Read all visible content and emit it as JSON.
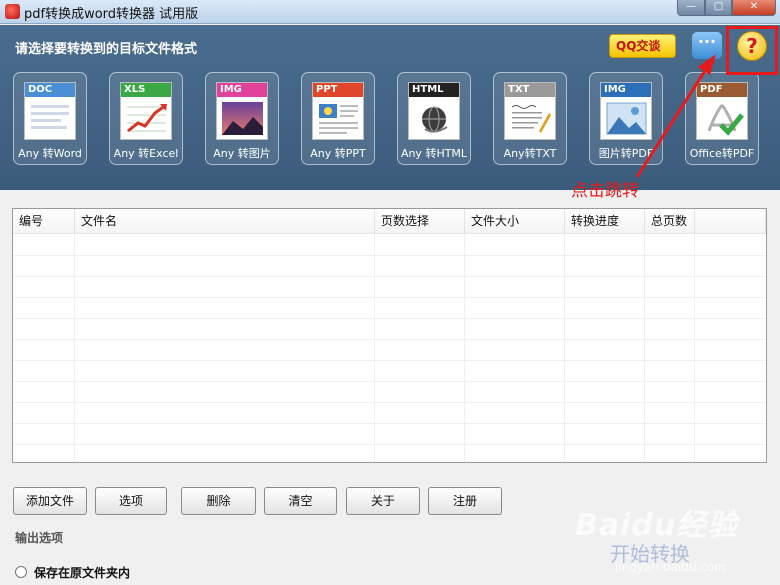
{
  "window": {
    "title": "pdf转换成word转换器 试用版",
    "min_glyph": "—",
    "max_glyph": "□",
    "close_glyph": "✕"
  },
  "toolbar": {
    "prompt": "请选择要转换到的目标文件格式",
    "qq_label": "QQ交谈",
    "chat_glyph": "···",
    "help_glyph": "?"
  },
  "formats": [
    {
      "tag": "DOC",
      "label": "Any 转Word",
      "color": "#4a8fd6",
      "icon": "word-doc-icon"
    },
    {
      "tag": "XLS",
      "label": "Any 转Excel",
      "color": "#3aa845",
      "icon": "excel-chart-icon"
    },
    {
      "tag": "IMG",
      "label": "Any 转图片",
      "color": "#e0429a",
      "icon": "image-icon"
    },
    {
      "tag": "PPT",
      "label": "Any 转PPT",
      "color": "#e0462a",
      "icon": "ppt-icon"
    },
    {
      "tag": "HTML",
      "label": "Any 转HTML",
      "color": "#222222",
      "icon": "html-globe-icon"
    },
    {
      "tag": "TXT",
      "label": "Any转TXT",
      "color": "#9a9a9a",
      "icon": "txt-pen-icon"
    },
    {
      "tag": "IMG",
      "label": "图片转PDF",
      "color": "#2a6fb7",
      "icon": "image-to-pdf-icon"
    },
    {
      "tag": "PDF",
      "label": "Office转PDF",
      "color": "#9a5a32",
      "icon": "office-to-pdf-icon"
    }
  ],
  "annotation": {
    "text": "点击跳转"
  },
  "table": {
    "columns": [
      "编号",
      "文件名",
      "页数选择",
      "文件大小",
      "转换进度",
      "总页数"
    ]
  },
  "buttons": {
    "add_file": "添加文件",
    "options": "选项",
    "delete": "删除",
    "clear": "清空",
    "about": "关于",
    "register": "注册"
  },
  "output": {
    "title": "输出选项",
    "save_in_source": "保存在原文件夹内"
  },
  "watermark": {
    "brand": "Baidu经验",
    "sub": "开始转换",
    "url": "jingyan.baidu.com"
  }
}
